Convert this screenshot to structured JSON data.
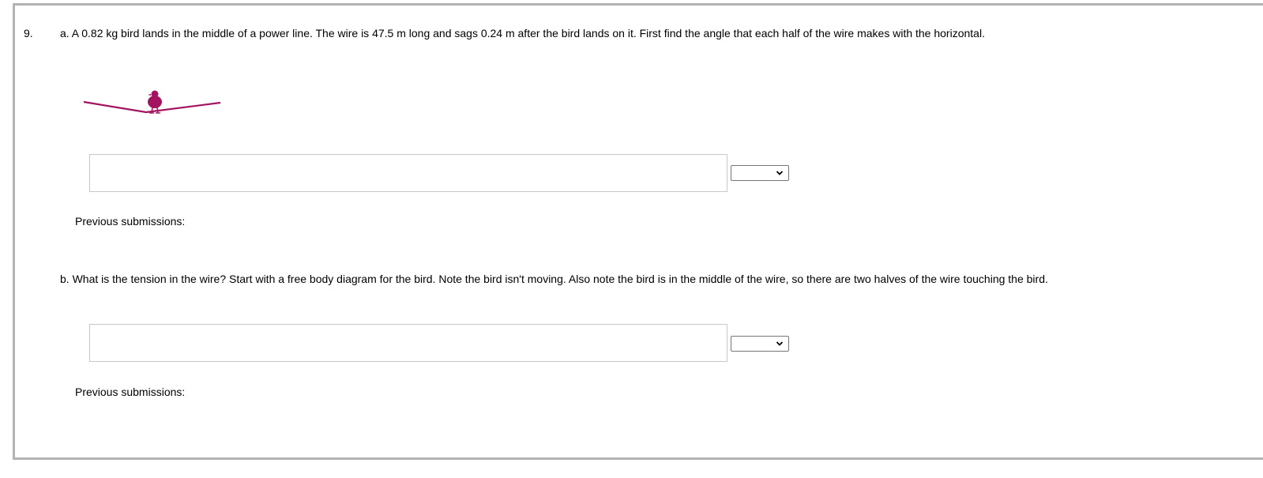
{
  "question": {
    "number": "9.",
    "part_a": {
      "prompt": "a. A 0.82 kg bird lands in the middle of a power line. The wire is 47.5 m long and sags 0.24 m after the bird lands on it. First find the angle that each half of the wire makes with the horizontal.",
      "answer_value": "",
      "unit_selected": "",
      "previous_submissions_label": "Previous submissions:"
    },
    "part_b": {
      "prompt": "b. What is the tension in the wire? Start with a free body diagram for the bird. Note the bird isn't moving. Also note the bird is in the middle of the wire, so there are two halves of the wire touching the bird.",
      "answer_value": "",
      "unit_selected": "",
      "previous_submissions_label": "Previous submissions:"
    }
  },
  "colors": {
    "figure": "#a3135f",
    "frame_border": "#b3b3b3",
    "input_border": "#c8c8c8"
  },
  "icons": {
    "figure": "bird-on-wire",
    "select": "chevron-down-icon"
  }
}
